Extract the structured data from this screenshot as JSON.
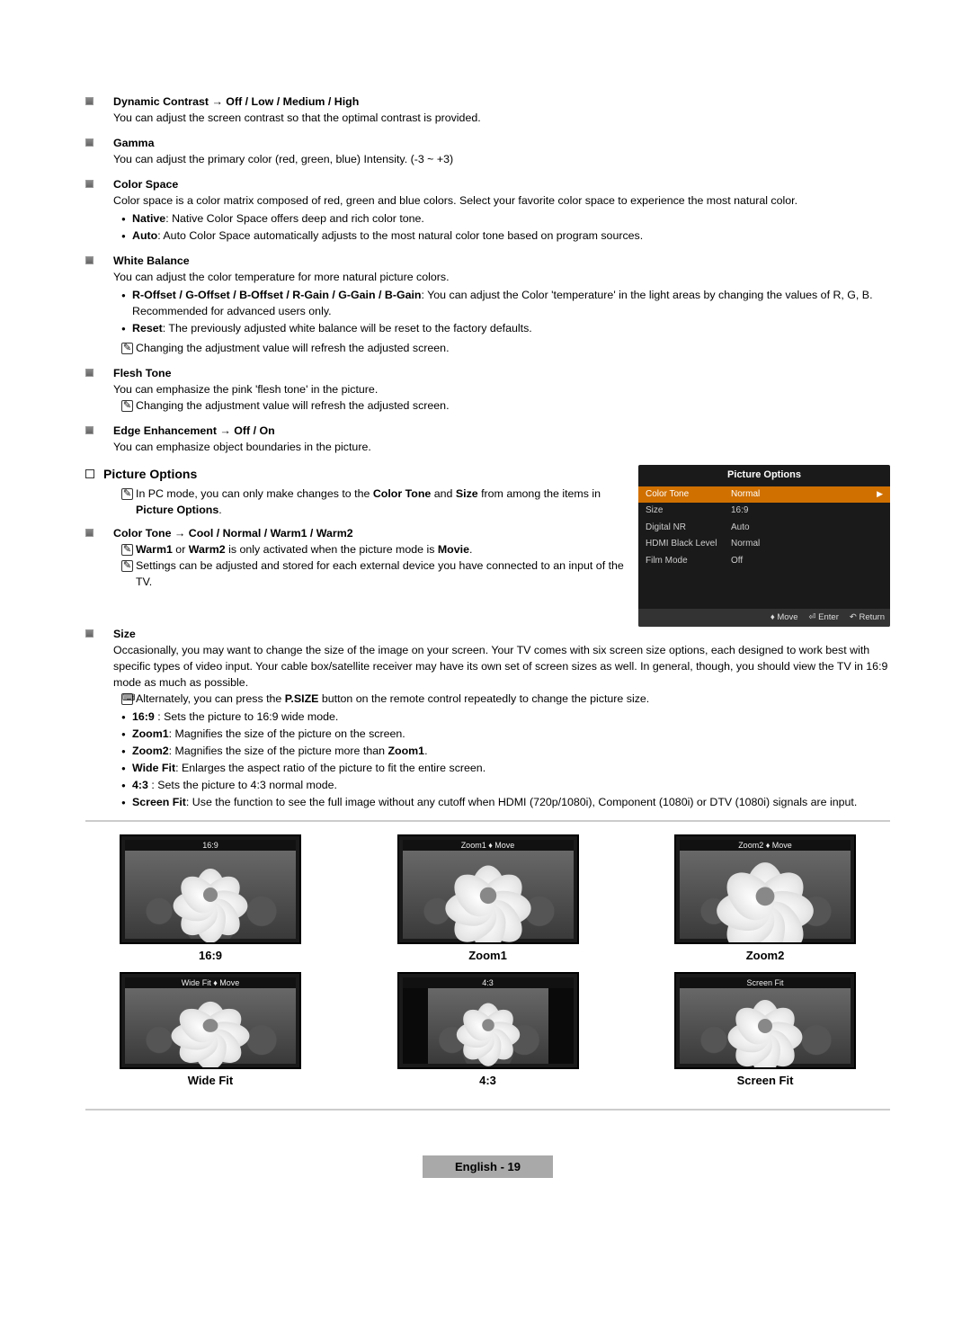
{
  "items": [
    {
      "title": "Dynamic Contrast → Off / Low / Medium / High",
      "desc": "You can adjust the screen contrast so that the optimal contrast is provided."
    },
    {
      "title": "Gamma",
      "desc": "You can adjust the primary color (red, green, blue) Intensity. (-3 ~ +3)"
    },
    {
      "title": "Color Space",
      "desc": "Color space is a color matrix composed of red, green and blue colors. Select your favorite color space to experience the most natural color.",
      "bullets": [
        {
          "b": "Native",
          "t": ": Native Color Space offers deep and rich color tone."
        },
        {
          "b": "Auto",
          "t": ": Auto Color Space automatically adjusts to the most natural color tone based on program sources."
        }
      ]
    },
    {
      "title": "White Balance",
      "desc": "You can adjust the color temperature for more natural picture colors.",
      "bullets": [
        {
          "b": "R-Offset / G-Offset / B-Offset / R-Gain / G-Gain / B-Gain",
          "t": ": You can adjust the Color 'temperature' in the light areas by changing the values of R, G, B. Recommended for advanced users only."
        },
        {
          "b": "Reset",
          "t": ": The previously adjusted white balance will be reset to the factory defaults."
        }
      ],
      "note": "Changing the adjustment value will refresh the adjusted screen."
    },
    {
      "title": "Flesh Tone",
      "desc": "You can emphasize the pink 'flesh tone' in the picture.",
      "note": "Changing the adjustment value will refresh the adjusted screen."
    },
    {
      "title": "Edge Enhancement → Off / On",
      "desc": "You can emphasize object boundaries in the picture."
    }
  ],
  "section2": {
    "title": "Picture Options",
    "note1a": "In PC mode, you can only make changes to the ",
    "note1b": "Color Tone",
    "note1c": " and ",
    "note1d": "Size",
    "note1e": " from among the items in ",
    "note1f": "Picture Options",
    "note1g": "."
  },
  "colorTone": {
    "title": "Color Tone → Cool / Normal / Warm1 / Warm2",
    "note1a": "Warm1",
    "note1b": " or ",
    "note1c": "Warm2",
    "note1d": " is only activated when the picture mode is ",
    "note1e": "Movie",
    "note1f": ".",
    "note2": "Settings can be adjusted and stored for each external device you have connected to an input of the TV."
  },
  "size": {
    "title": "Size",
    "desc": "Occasionally, you may want to change the size of the image on your screen. Your TV comes with six screen size options, each designed to work best with specific types of video input. Your cable box/satellite receiver may have its own set of screen sizes as well. In general, though, you should view the TV in 16:9 mode as much as possible.",
    "info_a": "Alternately, you can press the ",
    "info_b": "P.SIZE",
    "info_c": " button on the remote control repeatedly to change the picture size.",
    "bullets": [
      {
        "b": "16:9",
        "t": " : Sets the picture to 16:9 wide mode."
      },
      {
        "b": "Zoom1",
        "t": ": Magnifies the size of the picture on the screen."
      },
      {
        "b": "Zoom2",
        "t": ": Magnifies the size of the picture more than ",
        "b2": "Zoom1",
        "t2": "."
      },
      {
        "b": "Wide Fit",
        "t": ": Enlarges the aspect ratio of the picture to fit the entire screen."
      },
      {
        "b": "4:3",
        "t": " : Sets the picture to 4:3 normal mode."
      },
      {
        "b": "Screen Fit",
        "t": ": Use the function to see the full image without any cutoff when HDMI (720p/1080i), Component (1080i) or DTV (1080i) signals are input."
      }
    ]
  },
  "osd": {
    "title": "Picture Options",
    "rows": [
      {
        "k": "Color Tone",
        "v": "Normal",
        "hl": true
      },
      {
        "k": "Size",
        "v": "16:9"
      },
      {
        "k": "Digital NR",
        "v": "Auto"
      },
      {
        "k": "HDMI Black Level",
        "v": "Normal"
      },
      {
        "k": "Film Mode",
        "v": "Off"
      }
    ],
    "foot": {
      "move": "Move",
      "enter": "Enter",
      "return": "Return"
    }
  },
  "tiles": {
    "r1": [
      {
        "band": "16:9",
        "label": "16:9"
      },
      {
        "band": "Zoom1 ♦ Move",
        "label": "Zoom1"
      },
      {
        "band": "Zoom2 ♦ Move",
        "label": "Zoom2"
      }
    ],
    "r2": [
      {
        "band": "Wide Fit ♦ Move",
        "label": "Wide Fit"
      },
      {
        "band": "4:3",
        "label": "4:3"
      },
      {
        "band": "Screen Fit",
        "label": "Screen Fit"
      }
    ]
  },
  "footer": "English - 19"
}
